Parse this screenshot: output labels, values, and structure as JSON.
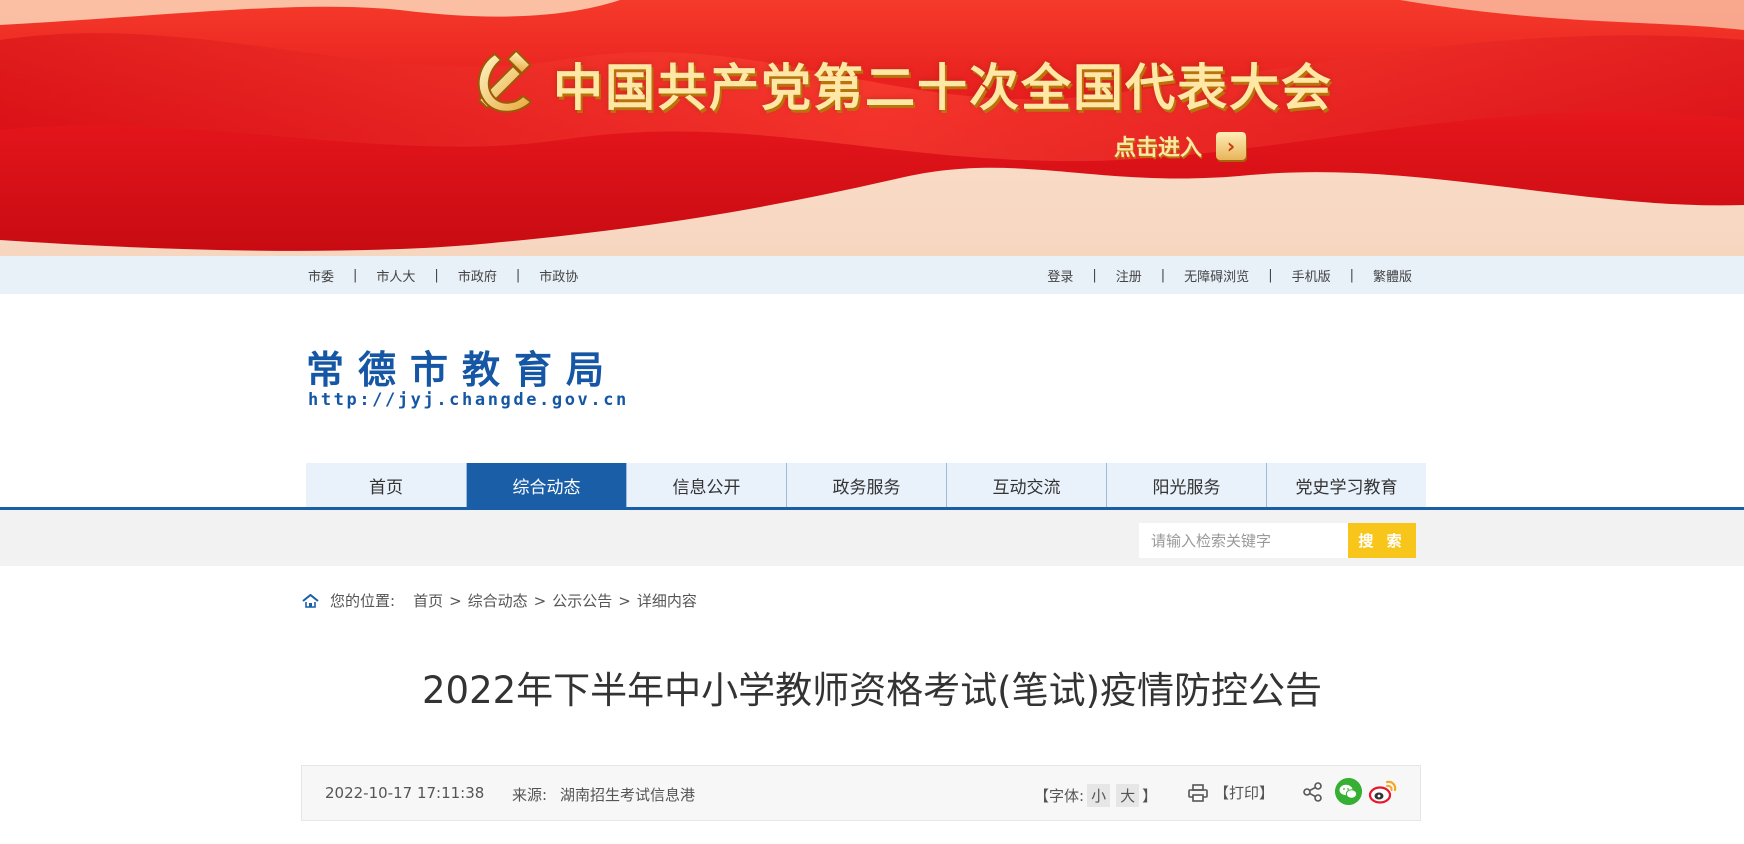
{
  "banner": {
    "title": "中国共产党第二十次全国代表大会",
    "enter_label": "点击进入",
    "arrow_glyph": "›"
  },
  "topbar": {
    "left": [
      "市委",
      "市人大",
      "市政府",
      "市政协"
    ],
    "right": [
      "登录",
      "注册",
      "无障碍浏览",
      "手机版",
      "繁體版"
    ],
    "separator": "|"
  },
  "header": {
    "logo_cn": "常德市教育局",
    "logo_url": "http://jyj.changde.gov.cn"
  },
  "nav": {
    "items": [
      "首页",
      "综合动态",
      "信息公开",
      "政务服务",
      "互动交流",
      "阳光服务",
      "党史学习教育"
    ],
    "active": "综合动态"
  },
  "search": {
    "placeholder": "请输入检索关键字",
    "button_label": "搜 索"
  },
  "breadcrumb": {
    "label": "您的位置:",
    "items": [
      "首页",
      "综合动态",
      "公示公告",
      "详细内容"
    ],
    "separator": ">"
  },
  "article": {
    "title": "2022年下半年中小学教师资格考试(笔试)疫情防控公告",
    "date": "2022-10-17 17:11:38",
    "source_label": "来源:",
    "source": "湖南招生考试信息港",
    "font_label_open": "【字体:",
    "font_small": "小",
    "font_large": "大",
    "font_label_close": "】",
    "print_label": "【打印】"
  },
  "colors": {
    "brand_blue": "#1a5ea8",
    "banner_red": "#e5141b",
    "gold": "#ffe7a6",
    "search_yellow": "#f8c51b"
  },
  "icons": [
    "party-emblem-icon",
    "chevron-right-icon",
    "home-icon",
    "printer-icon",
    "share-icon",
    "wechat-icon",
    "weibo-icon"
  ]
}
